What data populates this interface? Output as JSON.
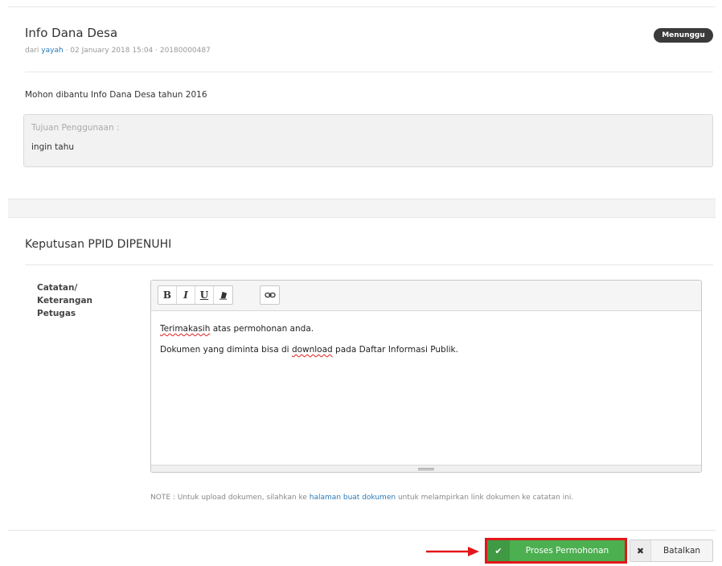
{
  "request": {
    "title": "Info Dana Desa",
    "meta_prefix": "dari ",
    "requester": "yayah",
    "meta_suffix": " · 02 January 2018 15:04 · 20180000487",
    "status_badge": "Menunggu",
    "message": "Mohon dibantu Info Dana Desa tahun 2016",
    "purpose_label": "Tujuan Penggunaan :",
    "purpose_value": "ingin tahu"
  },
  "decision": {
    "title": "Keputusan PPID DIPENUHI",
    "field_label": "Catatan/ Keterangan Petugas",
    "toolbar": {
      "bold": "B",
      "italic": "I",
      "underline": "U",
      "clear_format_icon": "eraser-icon",
      "link_icon": "link-icon"
    },
    "editor_text": {
      "line1_word1": "Terimakasih",
      "line1_rest": " atas permohonan anda.",
      "line2_part1": "Dokumen yang diminta bisa di ",
      "line2_word": "download",
      "line2_part2": " pada Daftar Informasi Publik."
    },
    "note_prefix": "NOTE : Untuk upload dokumen, silahkan ke ",
    "note_link": "halaman buat dokumen",
    "note_suffix": " untuk melampirkan link dokumen ke catatan ini."
  },
  "actions": {
    "process_label": "Proses Permohonan",
    "process_icon": "check-icon",
    "cancel_label": "Batalkan",
    "cancel_icon": "times-icon"
  },
  "colors": {
    "primary_green": "#4caf50",
    "highlight_red": "#e2171b",
    "link_blue": "#2a7ab8",
    "badge_dark": "#3a3a3a"
  }
}
